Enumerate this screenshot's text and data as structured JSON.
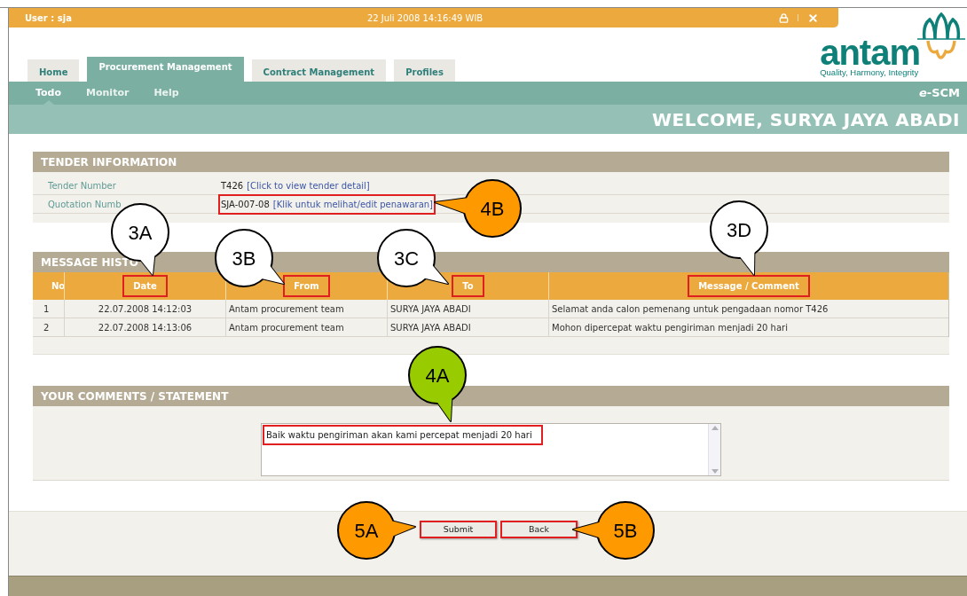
{
  "top_bar": {
    "user": "User : sja",
    "datetime": "22 Juli 2008 14:16:49 WIB"
  },
  "logo": {
    "name": "antam",
    "tagline": "Quality, Harmony, Integrity"
  },
  "tabs": [
    {
      "label": "Home",
      "selected": false
    },
    {
      "label": "Procurement Management",
      "selected": true
    },
    {
      "label": "Contract Management",
      "selected": false
    },
    {
      "label": "Profiles",
      "selected": false
    }
  ],
  "subnav": [
    {
      "label": "Todo",
      "selected": true
    },
    {
      "label": "Monitor",
      "selected": false
    },
    {
      "label": "Help",
      "selected": false
    }
  ],
  "app_name": "*e*-SCM",
  "welcome": "WELCOME, SURYA JAYA ABADI",
  "tender_information": {
    "title": "TENDER INFORMATION",
    "rows": [
      {
        "label": "Tender Number",
        "value": "T426",
        "link": "[Click to view tender detail]",
        "highlighted": false
      },
      {
        "label": "Quotation Numb",
        "value": "SJA-007-08",
        "link": "[Klik untuk melihat/edit penawaran]",
        "highlighted": true
      }
    ]
  },
  "message_history": {
    "title": "MESSAGE HISTO",
    "columns": [
      {
        "label": "No",
        "highlighted": false
      },
      {
        "label": "Date",
        "highlighted": true
      },
      {
        "label": "From",
        "highlighted": true
      },
      {
        "label": "To",
        "highlighted": true
      },
      {
        "label": "Message / Comment",
        "highlighted": true
      }
    ],
    "rows": [
      [
        "1",
        "22.07.2008 14:12:03",
        "Antam procurement team",
        "SURYA JAYA ABADI",
        "Selamat anda calon pemenang untuk pengadaan nomor T426"
      ],
      [
        "2",
        "22.07.2008 14:13:06",
        "Antam procurement team",
        "SURYA JAYA ABADI",
        "Mohon dipercepat waktu pengiriman menjadi 20 hari"
      ]
    ]
  },
  "comments": {
    "title": "YOUR COMMENTS / STATEMENT",
    "value": "Baik waktu pengiriman akan kami percepat menjadi 20 hari",
    "highlighted": true
  },
  "buttons": [
    {
      "label": "Submit",
      "highlighted": true
    },
    {
      "label": "Back",
      "highlighted": true
    }
  ],
  "callouts": [
    {
      "label": "3A",
      "color": "#ffffff"
    },
    {
      "label": "3B",
      "color": "#ffffff"
    },
    {
      "label": "3C",
      "color": "#ffffff"
    },
    {
      "label": "3D",
      "color": "#ffffff"
    },
    {
      "label": "4B",
      "color": "#ff9900"
    },
    {
      "label": "4A",
      "color": "#99cc00"
    },
    {
      "label": "5A",
      "color": "#ff9900"
    },
    {
      "label": "5B",
      "color": "#ff9900"
    }
  ]
}
